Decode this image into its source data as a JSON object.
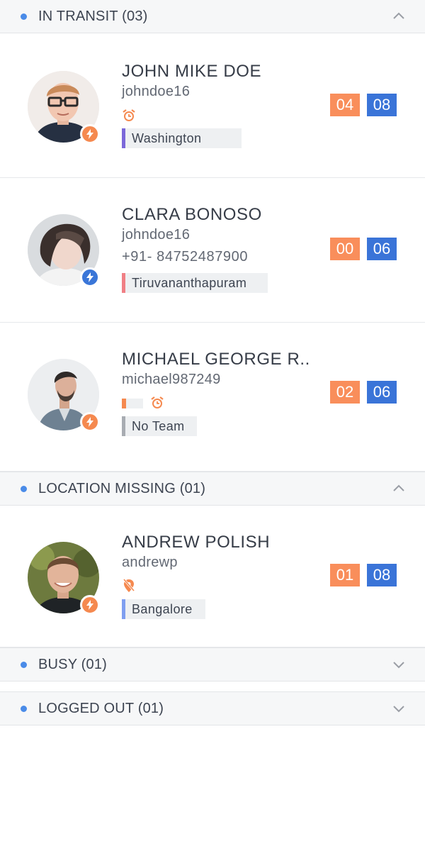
{
  "sections": [
    {
      "title": "IN TRANSIT (03)",
      "expanded": true
    },
    {
      "title": "LOCATION MISSING (01)",
      "expanded": true
    },
    {
      "title": "BUSY (01)",
      "expanded": false
    },
    {
      "title": "LOGGED OUT (01)",
      "expanded": false
    }
  ],
  "people": [
    {
      "name": "JOHN MIKE DOE",
      "username": "johndoe16",
      "status_icon": "alarm-clock-icon",
      "team": "Washington",
      "team_color": "#7b68d9",
      "count_a": "04",
      "count_b": "08",
      "badge": "orange"
    },
    {
      "name": "CLARA BONOSO",
      "username": "johndoe16",
      "phone": "+91- 84752487900",
      "team": "Tiruvananthapuram",
      "team_color": "#f07f85",
      "count_a": "00",
      "count_b": "06",
      "badge": "blue"
    },
    {
      "name": "MICHAEL GEORGE R..",
      "username": "michael987249",
      "status_icon": "alarm-clock-icon",
      "team": "No Team",
      "team_color": "#a8acb2",
      "count_a": "02",
      "count_b": "06",
      "badge": "orange"
    },
    {
      "name": "ANDREW POLISH",
      "username": "andrewp",
      "status_icon": "location-off-icon",
      "team": "Bangalore",
      "team_color": "#7f9ef0",
      "count_a": "01",
      "count_b": "08",
      "badge": "orange"
    }
  ],
  "colors": {
    "accent_blue": "#3a74d8",
    "accent_orange": "#f98e5b",
    "section_dot": "#4a8be8"
  }
}
